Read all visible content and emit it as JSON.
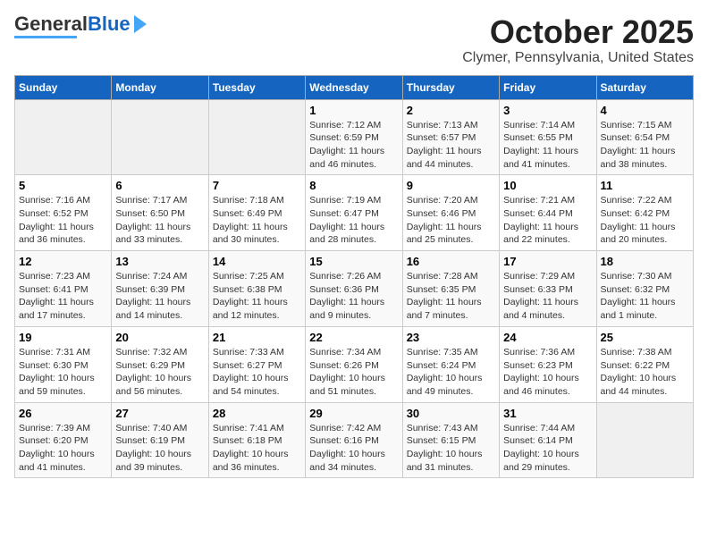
{
  "header": {
    "logo_general": "General",
    "logo_blue": "Blue",
    "month": "October 2025",
    "location": "Clymer, Pennsylvania, United States"
  },
  "days_of_week": [
    "Sunday",
    "Monday",
    "Tuesday",
    "Wednesday",
    "Thursday",
    "Friday",
    "Saturday"
  ],
  "weeks": [
    [
      {
        "day": "",
        "info": ""
      },
      {
        "day": "",
        "info": ""
      },
      {
        "day": "",
        "info": ""
      },
      {
        "day": "1",
        "info": "Sunrise: 7:12 AM\nSunset: 6:59 PM\nDaylight: 11 hours and 46 minutes."
      },
      {
        "day": "2",
        "info": "Sunrise: 7:13 AM\nSunset: 6:57 PM\nDaylight: 11 hours and 44 minutes."
      },
      {
        "day": "3",
        "info": "Sunrise: 7:14 AM\nSunset: 6:55 PM\nDaylight: 11 hours and 41 minutes."
      },
      {
        "day": "4",
        "info": "Sunrise: 7:15 AM\nSunset: 6:54 PM\nDaylight: 11 hours and 38 minutes."
      }
    ],
    [
      {
        "day": "5",
        "info": "Sunrise: 7:16 AM\nSunset: 6:52 PM\nDaylight: 11 hours and 36 minutes."
      },
      {
        "day": "6",
        "info": "Sunrise: 7:17 AM\nSunset: 6:50 PM\nDaylight: 11 hours and 33 minutes."
      },
      {
        "day": "7",
        "info": "Sunrise: 7:18 AM\nSunset: 6:49 PM\nDaylight: 11 hours and 30 minutes."
      },
      {
        "day": "8",
        "info": "Sunrise: 7:19 AM\nSunset: 6:47 PM\nDaylight: 11 hours and 28 minutes."
      },
      {
        "day": "9",
        "info": "Sunrise: 7:20 AM\nSunset: 6:46 PM\nDaylight: 11 hours and 25 minutes."
      },
      {
        "day": "10",
        "info": "Sunrise: 7:21 AM\nSunset: 6:44 PM\nDaylight: 11 hours and 22 minutes."
      },
      {
        "day": "11",
        "info": "Sunrise: 7:22 AM\nSunset: 6:42 PM\nDaylight: 11 hours and 20 minutes."
      }
    ],
    [
      {
        "day": "12",
        "info": "Sunrise: 7:23 AM\nSunset: 6:41 PM\nDaylight: 11 hours and 17 minutes."
      },
      {
        "day": "13",
        "info": "Sunrise: 7:24 AM\nSunset: 6:39 PM\nDaylight: 11 hours and 14 minutes."
      },
      {
        "day": "14",
        "info": "Sunrise: 7:25 AM\nSunset: 6:38 PM\nDaylight: 11 hours and 12 minutes."
      },
      {
        "day": "15",
        "info": "Sunrise: 7:26 AM\nSunset: 6:36 PM\nDaylight: 11 hours and 9 minutes."
      },
      {
        "day": "16",
        "info": "Sunrise: 7:28 AM\nSunset: 6:35 PM\nDaylight: 11 hours and 7 minutes."
      },
      {
        "day": "17",
        "info": "Sunrise: 7:29 AM\nSunset: 6:33 PM\nDaylight: 11 hours and 4 minutes."
      },
      {
        "day": "18",
        "info": "Sunrise: 7:30 AM\nSunset: 6:32 PM\nDaylight: 11 hours and 1 minute."
      }
    ],
    [
      {
        "day": "19",
        "info": "Sunrise: 7:31 AM\nSunset: 6:30 PM\nDaylight: 10 hours and 59 minutes."
      },
      {
        "day": "20",
        "info": "Sunrise: 7:32 AM\nSunset: 6:29 PM\nDaylight: 10 hours and 56 minutes."
      },
      {
        "day": "21",
        "info": "Sunrise: 7:33 AM\nSunset: 6:27 PM\nDaylight: 10 hours and 54 minutes."
      },
      {
        "day": "22",
        "info": "Sunrise: 7:34 AM\nSunset: 6:26 PM\nDaylight: 10 hours and 51 minutes."
      },
      {
        "day": "23",
        "info": "Sunrise: 7:35 AM\nSunset: 6:24 PM\nDaylight: 10 hours and 49 minutes."
      },
      {
        "day": "24",
        "info": "Sunrise: 7:36 AM\nSunset: 6:23 PM\nDaylight: 10 hours and 46 minutes."
      },
      {
        "day": "25",
        "info": "Sunrise: 7:38 AM\nSunset: 6:22 PM\nDaylight: 10 hours and 44 minutes."
      }
    ],
    [
      {
        "day": "26",
        "info": "Sunrise: 7:39 AM\nSunset: 6:20 PM\nDaylight: 10 hours and 41 minutes."
      },
      {
        "day": "27",
        "info": "Sunrise: 7:40 AM\nSunset: 6:19 PM\nDaylight: 10 hours and 39 minutes."
      },
      {
        "day": "28",
        "info": "Sunrise: 7:41 AM\nSunset: 6:18 PM\nDaylight: 10 hours and 36 minutes."
      },
      {
        "day": "29",
        "info": "Sunrise: 7:42 AM\nSunset: 6:16 PM\nDaylight: 10 hours and 34 minutes."
      },
      {
        "day": "30",
        "info": "Sunrise: 7:43 AM\nSunset: 6:15 PM\nDaylight: 10 hours and 31 minutes."
      },
      {
        "day": "31",
        "info": "Sunrise: 7:44 AM\nSunset: 6:14 PM\nDaylight: 10 hours and 29 minutes."
      },
      {
        "day": "",
        "info": ""
      }
    ]
  ]
}
